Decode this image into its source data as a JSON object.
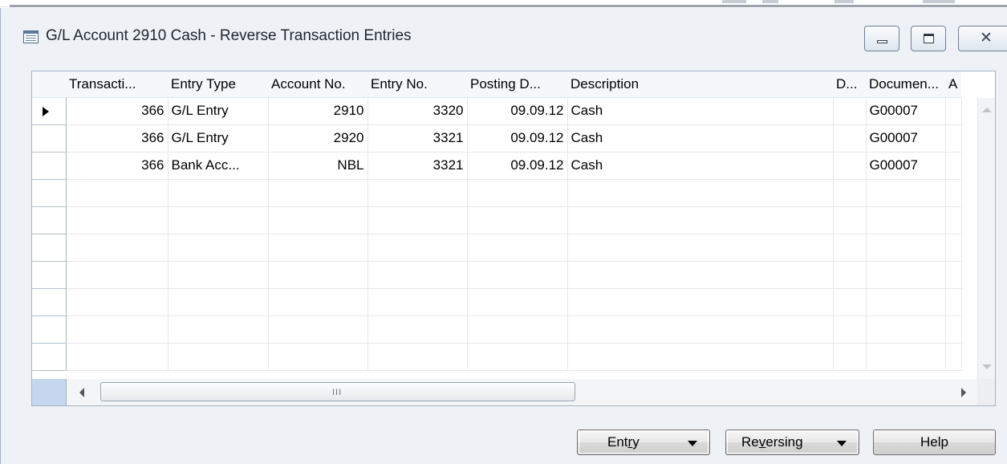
{
  "window": {
    "title": "G/L Account 2910 Cash - Reverse Transaction Entries",
    "title_icon": "form-icon",
    "controls": [
      "minimize-icon",
      "maximize-icon",
      "close-icon"
    ]
  },
  "grid": {
    "columns": [
      {
        "key": "transaction",
        "label": "Transacti..."
      },
      {
        "key": "entry_type",
        "label": "Entry Type"
      },
      {
        "key": "account_no",
        "label": "Account No."
      },
      {
        "key": "entry_no",
        "label": "Entry No."
      },
      {
        "key": "posting_date",
        "label": "Posting D..."
      },
      {
        "key": "description",
        "label": "Description"
      },
      {
        "key": "d",
        "label": "D..."
      },
      {
        "key": "document",
        "label": "Documen..."
      },
      {
        "key": "a",
        "label": "A"
      }
    ],
    "rows": [
      {
        "transaction": "366",
        "entry_type": "G/L Entry",
        "account_no": "2910",
        "entry_no": "3320",
        "posting_date": "09.09.12",
        "description": "Cash",
        "d": "",
        "document": "G00007",
        "a": ""
      },
      {
        "transaction": "366",
        "entry_type": "G/L Entry",
        "account_no": "2920",
        "entry_no": "3321",
        "posting_date": "09.09.12",
        "description": "Cash",
        "d": "",
        "document": "G00007",
        "a": ""
      },
      {
        "transaction": "366",
        "entry_type": "Bank Acc...",
        "account_no": "NBL",
        "entry_no": "3321",
        "posting_date": "09.09.12",
        "description": "Cash",
        "d": "",
        "document": "G00007",
        "a": ""
      }
    ],
    "empty_rows": 7,
    "selected_row": 0,
    "hscroll_grip": "III"
  },
  "buttons": {
    "entry": {
      "pre": "Ent",
      "mnemonic": "r",
      "post": "y"
    },
    "reversing": {
      "pre": "Re",
      "mnemonic": "v",
      "post": "ersing"
    },
    "help": "Help"
  }
}
